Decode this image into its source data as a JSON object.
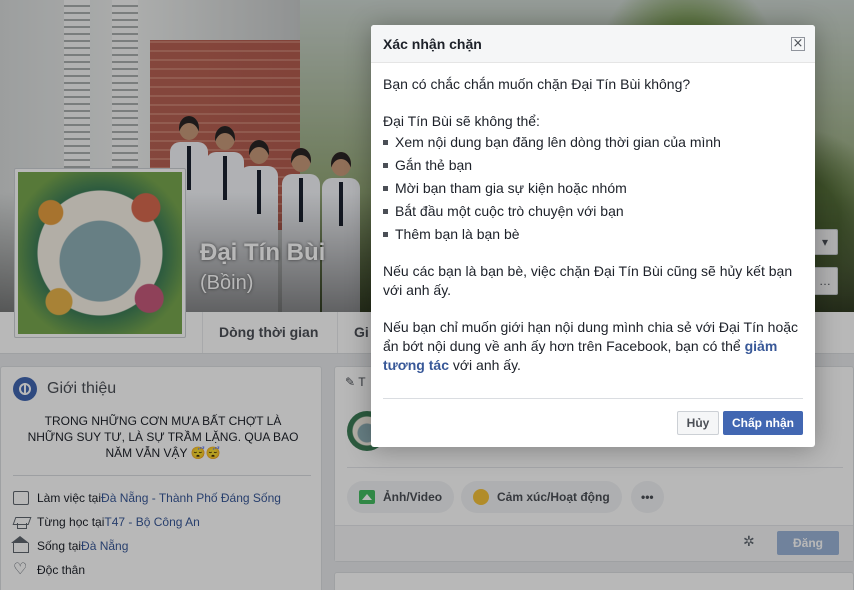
{
  "profile": {
    "name": "Đại Tín Bùi",
    "alt_name": "(Bồin)"
  },
  "nav": {
    "tabs": [
      "Dòng thời gian",
      "Gi"
    ]
  },
  "intro": {
    "title": "Giới thiệu",
    "bio": "TRONG NHỮNG CƠN MƯA BẤT CHỢT LÀ NHỮNG SUY TƯ, LÀ SỰ TRẦM LẶNG. QUA BAO NĂM VẪN VẬY 😴😴",
    "work_prefix": "Làm việc tại ",
    "work_link": "Đà Nẵng - Thành Phố Đáng Sống",
    "study_prefix": "Từng học tại ",
    "study_link": "T47 - Bộ Công An",
    "live_prefix": "Sống tại ",
    "live_link": "Đà Nẵng",
    "relationship": "Độc thân"
  },
  "composer": {
    "tab_label": "T",
    "photo_label": "Ảnh/Video",
    "feeling_label": "Cảm xúc/Hoạt động",
    "more_label": "•••",
    "post_label": "Đăng"
  },
  "dialog": {
    "title": "Xác nhận chặn",
    "question": "Bạn có chắc chắn muốn chặn Đại Tín Bùi không?",
    "cannot_intro": "Đại Tín Bùi sẽ không thể:",
    "items": [
      "Xem nội dung bạn đăng lên dòng thời gian của mình",
      "Gắn thẻ bạn",
      "Mời bạn tham gia sự kiện hoặc nhóm",
      "Bắt đầu một cuộc trò chuyện với bạn",
      "Thêm bạn là bạn bè"
    ],
    "friend_note": "Nếu các bạn là bạn bè, việc chặn Đại Tín Bùi cũng sẽ hủy kết bạn với anh ấy.",
    "limit_note_before": "Nếu bạn chỉ muốn giới hạn nội dung mình chia sẻ với Đại Tín hoặc ẩn bớt nội dung về anh ấy hơn trên Facebook, bạn có thể ",
    "limit_note_link": "giảm tương tác",
    "limit_note_after": " với anh ấy.",
    "cancel_label": "Hủy",
    "accept_label": "Chấp nhận"
  },
  "colors": {
    "accent": "#4267b2",
    "link": "#385898"
  }
}
